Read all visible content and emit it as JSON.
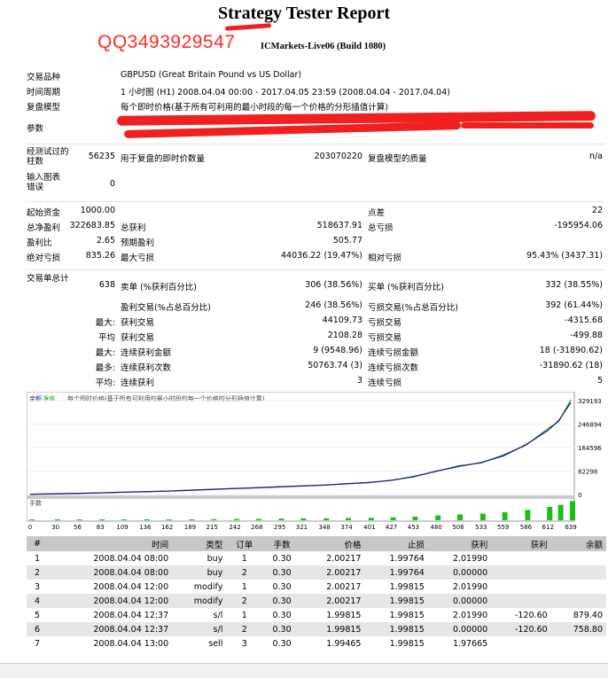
{
  "report": {
    "title": "Strategy Tester Report",
    "broker_build": "ICMarkets-Live06 (Build 1080)",
    "watermark": "QQ3493929547"
  },
  "summary": {
    "symbol_label": "交易品种",
    "symbol_value": "GBPUSD (Great Britain Pound vs US Dollar)",
    "period_label": "时间周期",
    "period_value": "1 小时图 (H1) 2008.04.04 00:00 - 2017.04.05 23:59 (2008.04.04 - 2017.04.04)",
    "model_label": "复盘模型",
    "model_value": "每个即时价格(基于所有可利用的最小时段的每一个价格的分形插值计算)",
    "params_label": "参数",
    "bars_label": "经测试过的柱数",
    "bars_value": "56235",
    "ticks_label": "用于复盘的即时价数量",
    "ticks_value": "203070220",
    "quality_label": "复盘模型的质量",
    "quality_value": "n/a",
    "errors_label": "输入图表错误",
    "errors_value": "0",
    "deposit_label": "起始资金",
    "deposit_value": "1000.00",
    "spread_label": "点差",
    "spread_value": "22",
    "net_label": "总净盈利",
    "net_value": "322683.85",
    "gross_profit_label": "总获利",
    "gross_profit_value": "518637.91",
    "gross_loss_label": "总亏损",
    "gross_loss_value": "-195954.06",
    "pf_label": "盈利比",
    "pf_value": "2.65",
    "expected_label": "预期盈利",
    "expected_value": "505.77",
    "abs_dd_label": "绝对亏损",
    "abs_dd_value": "835.26",
    "max_dd_label": "最大亏损",
    "max_dd_value": "44036.22 (19.47%)",
    "rel_dd_label": "相对亏损",
    "rel_dd_value": "95.43% (3437.31)",
    "trades_label": "交易单总计",
    "trades_value": "638",
    "short_label": "卖单 (%获利百分比)",
    "short_value": "306 (38.56%)",
    "long_label": "买单 (%获利百分比)",
    "long_value": "332 (38.55%)",
    "profit_trades_label": "盈利交易(%占总百分比)",
    "profit_trades_value": "246 (38.56%)",
    "loss_trades_label": "亏损交易(%占总百分比)",
    "loss_trades_value": "392 (61.44%)",
    "largest_prefix": "最大:",
    "largest_profit_label": "获利交易",
    "largest_profit_value": "44109.73",
    "largest_loss_label": "亏损交易",
    "largest_loss_value": "-4315.68",
    "average_prefix": "平均",
    "avg_profit_label": "获利交易",
    "avg_profit_value": "2108.28",
    "avg_loss_label": "亏损交易",
    "avg_loss_value": "-499.88",
    "max_prefix": "最大:",
    "max_cons_wins_label": "连续获利金额",
    "max_cons_wins_value": "9 (9548.96)",
    "max_cons_losses_label": "连续亏损金额",
    "max_cons_losses_value": "18 (-31890.62)",
    "most_prefix": "最多:",
    "max_cons_profit_label": "连续获利次数",
    "max_cons_profit_value": "50763.74 (3)",
    "max_cons_loss_label": "连续亏损次数",
    "max_cons_loss_value": "-31890.62 (18)",
    "avg_cons_prefix": "平均:",
    "avg_cons_wins_label": "连续获利",
    "avg_cons_wins_value": "3",
    "avg_cons_losses_label": "连续亏损",
    "avg_cons_losses_value": "5"
  },
  "chart_data": {
    "type": "line",
    "legend": [
      "余额",
      "净值"
    ],
    "caption": "每个即时价格(基于所有可利用的最小时段的每一个价格的分形插值计算)",
    "y_ticks": [
      "329193",
      "246894",
      "164596",
      "82298",
      "0"
    ],
    "x_ticks": [
      "0",
      "30",
      "56",
      "83",
      "109",
      "136",
      "162",
      "189",
      "215",
      "242",
      "268",
      "295",
      "321",
      "348",
      "374",
      "401",
      "427",
      "453",
      "480",
      "506",
      "533",
      "559",
      "586",
      "612",
      "639"
    ],
    "x": [
      0,
      30,
      56,
      83,
      109,
      136,
      162,
      189,
      215,
      242,
      268,
      295,
      321,
      348,
      374,
      401,
      427,
      453,
      480,
      506,
      533,
      559,
      586,
      612,
      625,
      639
    ],
    "balance": [
      1000,
      2500,
      4000,
      6000,
      8000,
      10000,
      12000,
      15000,
      18000,
      21000,
      24000,
      27000,
      30000,
      33000,
      38000,
      42000,
      50000,
      62000,
      82000,
      98000,
      112000,
      135000,
      175000,
      225000,
      260000,
      322683
    ],
    "colors": {
      "balance": "#1a1a8c",
      "equity": "#22a022",
      "volume": "#19c019"
    },
    "volume_label": "手数"
  },
  "deals": {
    "headers": [
      "#",
      "时间",
      "类型",
      "订单",
      "手数",
      "价格",
      "止损",
      "获利",
      "获利",
      "余额"
    ],
    "rows": [
      [
        "1",
        "2008.04.04 08:00",
        "buy",
        "1",
        "0.30",
        "2.00217",
        "1.99764",
        "2.01990",
        "",
        ""
      ],
      [
        "2",
        "2008.04.04 08:00",
        "buy",
        "2",
        "0.30",
        "2.00217",
        "1.99764",
        "0.00000",
        "",
        ""
      ],
      [
        "3",
        "2008.04.04 12:00",
        "modify",
        "1",
        "0.30",
        "2.00217",
        "1.99815",
        "2.01990",
        "",
        ""
      ],
      [
        "4",
        "2008.04.04 12:00",
        "modify",
        "2",
        "0.30",
        "2.00217",
        "1.99815",
        "0.00000",
        "",
        ""
      ],
      [
        "5",
        "2008.04.04 12:37",
        "s/l",
        "1",
        "0.30",
        "1.99815",
        "1.99815",
        "2.01990",
        "-120.60",
        "879.40"
      ],
      [
        "6",
        "2008.04.04 12:37",
        "s/l",
        "2",
        "0.30",
        "1.99815",
        "1.99815",
        "0.00000",
        "-120.60",
        "758.80"
      ],
      [
        "7",
        "2008.04.04 13:00",
        "sell",
        "3",
        "0.30",
        "1.99465",
        "1.99815",
        "1.97665",
        "",
        ""
      ]
    ]
  }
}
